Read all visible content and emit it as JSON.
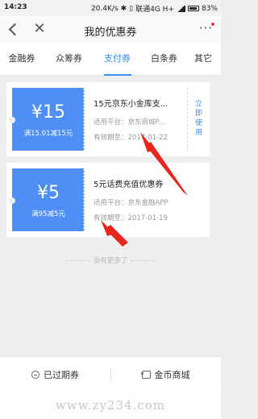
{
  "status_bar": {
    "time": "14:23",
    "speed": "20.4K/s",
    "carrier": "联通4G H+",
    "battery": "83%"
  },
  "nav": {
    "title": "我的优惠券",
    "more": "···"
  },
  "tabs": [
    {
      "label": "金融券",
      "active": false
    },
    {
      "label": "众筹券",
      "active": false
    },
    {
      "label": "支付券",
      "active": true
    },
    {
      "label": "白条券",
      "active": false
    },
    {
      "label": "其它",
      "active": false
    }
  ],
  "coupons": [
    {
      "amount": "¥15",
      "condition": "满15.01减15元",
      "name": "15元京东小金库支...",
      "platform_label": "适用平台：",
      "platform": "京东商城P...",
      "expiry_label": "有效期至：",
      "expiry": "2017-01-22",
      "action": [
        "立",
        "即",
        "使",
        "用"
      ]
    },
    {
      "amount": "¥5",
      "condition": "满95减5元",
      "name": "5元话费充值优惠券",
      "platform_label": "适用平台：",
      "platform": "京东金融APP",
      "expiry_label": "有效期至：",
      "expiry": "2017-01-19"
    }
  ],
  "no_more": "没有更多了",
  "bottom": {
    "expired": "已过期券",
    "shop": "金币商城"
  },
  "watermark": "www.zy234.com",
  "colors": {
    "accent": "#3a8df5",
    "coupon_blue": "#4e8ff5",
    "arrow_red": "#e8261c"
  }
}
